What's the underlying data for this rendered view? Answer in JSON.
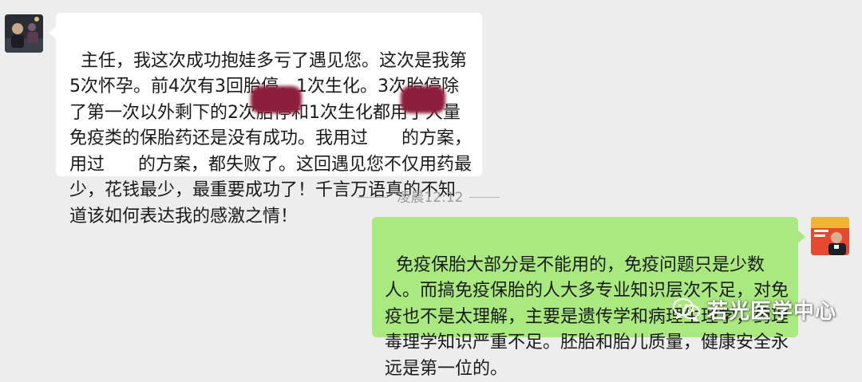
{
  "chat": {
    "incoming_message": "主任，我这次成功抱娃多亏了遇见您。这次是我第5次怀孕。前4次有3回胎停，1次生化。3次胎停除了第一次以外剩下的2次胎停和1次生化都用了大量免疫类的保胎药还是没有成功。我用过      的方案，用过      的方案，都失败了。这回遇见您不仅用药最少，花钱最少，最重要成功了！千言万语真的不知道该如何表达我的感激之情！",
    "timestamp": "凌晨12:12",
    "outgoing_message": "免疫保胎大部分是不能用的，免疫问题只是少数人。而搞免疫保胎的人大多专业知识层次不足，对免疫也不是太理解，主要是遗传学和病理生理学，药理毒理学知识严重不足。胚胎和胎儿质量，健康安全永远是第一位的。"
  },
  "watermark": {
    "text": "若光医学中心",
    "icon": "wechat-icon"
  },
  "colors": {
    "background": "#ededed",
    "incoming_bubble": "#ffffff",
    "outgoing_bubble": "#a9e97f",
    "redaction": "#8d1d3c"
  }
}
